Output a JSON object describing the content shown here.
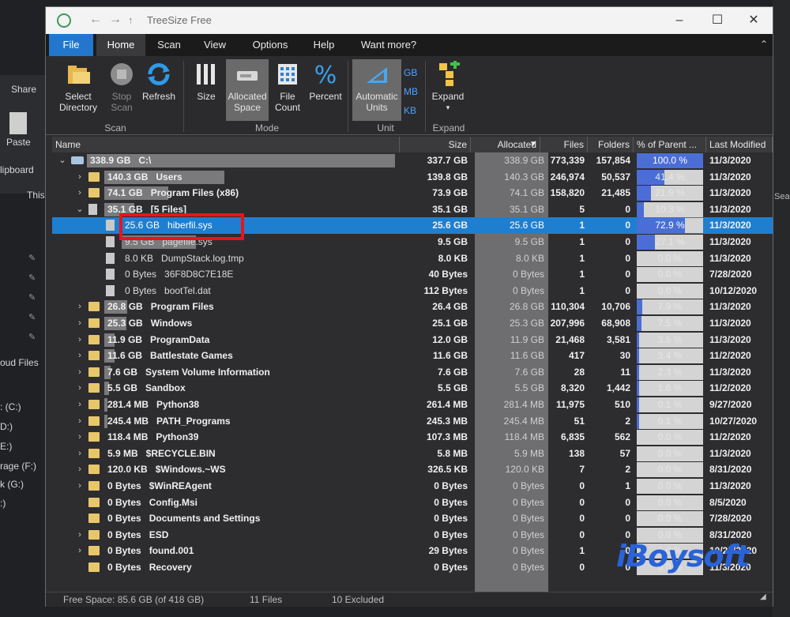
{
  "background": {
    "ribbon_share": "Share",
    "paste": "Paste",
    "clipboard": "lipboard",
    "this_pc": "This",
    "sidebar": [
      "oud Files",
      ": (C:)",
      "D:)",
      "E:)",
      "rage (F:)",
      "k (G:)",
      ":)"
    ],
    "search_partial": "Searc"
  },
  "window": {
    "title": "TreeSize Free",
    "minimize": "–",
    "maximize": "☐",
    "close": "✕"
  },
  "menu": {
    "file": "File",
    "items": [
      "Home",
      "Scan",
      "View",
      "Options",
      "Help",
      "Want more?"
    ],
    "active": "Home"
  },
  "ribbon": {
    "select_directory": "Select Directory",
    "stop_scan": "Stop Scan",
    "refresh": "Refresh",
    "group_scan": "Scan",
    "size": "Size",
    "allocated_space": "Allocated Space",
    "file_count": "File Count",
    "percent": "Percent",
    "group_mode": "Mode",
    "automatic_units": "Automatic Units",
    "gb": "GB",
    "mb": "MB",
    "kb": "KB",
    "group_unit": "Unit",
    "expand": "Expand",
    "group_expand": "Expand"
  },
  "columns": {
    "name": "Name",
    "size": "Size",
    "allocated": "Allocated",
    "files": "Files",
    "folders": "Folders",
    "pct_parent": "% of Parent ...",
    "last_modified": "Last Modified"
  },
  "rows": [
    {
      "name": "338.9 GB   C:\\",
      "size": "337.7 GB",
      "alloc": "338.9 GB",
      "files": "773,339",
      "folders": "157,854",
      "pct": "100.0 %",
      "pct_value": 100.0,
      "date": "11/3/2020",
      "level": 0,
      "type": "drive",
      "expand": "⌄",
      "bar_fraction": 1.0
    },
    {
      "name": "140.3 GB   Users",
      "size": "139.8 GB",
      "alloc": "140.3 GB",
      "files": "246,974",
      "folders": "50,537",
      "pct": "41.4 %",
      "pct_value": 41.4,
      "date": "11/3/2020",
      "level": 1,
      "type": "folder",
      "expand": "›",
      "bar_fraction": 0.414
    },
    {
      "name": "74.1 GB   Program Files (x86)",
      "size": "73.9 GB",
      "alloc": "74.1 GB",
      "files": "158,820",
      "folders": "21,485",
      "pct": "21.9 %",
      "pct_value": 21.9,
      "date": "11/3/2020",
      "level": 1,
      "type": "folder",
      "expand": "›",
      "bar_fraction": 0.219
    },
    {
      "name": "35.1 GB   [5 Files]",
      "size": "35.1 GB",
      "alloc": "35.1 GB",
      "files": "5",
      "folders": "0",
      "pct": "10.3 %",
      "pct_value": 10.3,
      "date": "11/3/2020",
      "level": 1,
      "type": "files",
      "expand": "⌄",
      "bar_fraction": 0.103
    },
    {
      "name": "25.6 GB   hiberfil.sys",
      "size": "25.6 GB",
      "alloc": "25.6 GB",
      "files": "1",
      "folders": "0",
      "pct": "72.9 %",
      "pct_value": 72.9,
      "date": "11/3/2020",
      "level": 2,
      "type": "file",
      "expand": "",
      "bar_fraction": 0.729,
      "selected": true
    },
    {
      "name": "9.5 GB   pagefile.sys",
      "size": "9.5 GB",
      "alloc": "9.5 GB",
      "files": "1",
      "folders": "0",
      "pct": "27.1 %",
      "pct_value": 27.1,
      "date": "11/3/2020",
      "level": 2,
      "type": "file",
      "expand": "",
      "bar_fraction": 0.271
    },
    {
      "name": "8.0 KB   DumpStack.log.tmp",
      "size": "8.0 KB",
      "alloc": "8.0 KB",
      "files": "1",
      "folders": "0",
      "pct": "0.0 %",
      "pct_value": 0.0,
      "date": "11/3/2020",
      "level": 2,
      "type": "file",
      "expand": "",
      "bar_fraction": 0.0
    },
    {
      "name": "0 Bytes   36F8D8C7E18E",
      "size": "40 Bytes",
      "alloc": "0 Bytes",
      "files": "1",
      "folders": "0",
      "pct": "0.0 %",
      "pct_value": 0.0,
      "date": "7/28/2020",
      "level": 2,
      "type": "file",
      "expand": "",
      "bar_fraction": 0.0
    },
    {
      "name": "0 Bytes   bootTel.dat",
      "size": "112 Bytes",
      "alloc": "0 Bytes",
      "files": "1",
      "folders": "0",
      "pct": "0.0 %",
      "pct_value": 0.0,
      "date": "10/12/2020",
      "level": 2,
      "type": "file",
      "expand": "",
      "bar_fraction": 0.0
    },
    {
      "name": "26.8 GB   Program Files",
      "size": "26.4 GB",
      "alloc": "26.8 GB",
      "files": "110,304",
      "folders": "10,706",
      "pct": "7.9 %",
      "pct_value": 7.9,
      "date": "11/3/2020",
      "level": 1,
      "type": "folder",
      "expand": "›",
      "bar_fraction": 0.079
    },
    {
      "name": "25.3 GB   Windows",
      "size": "25.1 GB",
      "alloc": "25.3 GB",
      "files": "207,996",
      "folders": "68,908",
      "pct": "7.5 %",
      "pct_value": 7.5,
      "date": "11/3/2020",
      "level": 1,
      "type": "folder",
      "expand": "›",
      "bar_fraction": 0.075
    },
    {
      "name": "11.9 GB   ProgramData",
      "size": "12.0 GB",
      "alloc": "11.9 GB",
      "files": "21,468",
      "folders": "3,581",
      "pct": "3.5 %",
      "pct_value": 3.5,
      "date": "11/3/2020",
      "level": 1,
      "type": "folder",
      "expand": "›",
      "bar_fraction": 0.035
    },
    {
      "name": "11.6 GB   Battlestate Games",
      "size": "11.6 GB",
      "alloc": "11.6 GB",
      "files": "417",
      "folders": "30",
      "pct": "3.4 %",
      "pct_value": 3.4,
      "date": "11/2/2020",
      "level": 1,
      "type": "folder",
      "expand": "›",
      "bar_fraction": 0.034
    },
    {
      "name": "7.6 GB   System Volume Information",
      "size": "7.6 GB",
      "alloc": "7.6 GB",
      "files": "28",
      "folders": "11",
      "pct": "2.3 %",
      "pct_value": 2.3,
      "date": "11/3/2020",
      "level": 1,
      "type": "folder",
      "expand": "›",
      "bar_fraction": 0.023
    },
    {
      "name": "5.5 GB   Sandbox",
      "size": "5.5 GB",
      "alloc": "5.5 GB",
      "files": "8,320",
      "folders": "1,442",
      "pct": "1.6 %",
      "pct_value": 1.6,
      "date": "11/2/2020",
      "level": 1,
      "type": "folder",
      "expand": "›",
      "bar_fraction": 0.016
    },
    {
      "name": "281.4 MB   Python38",
      "size": "261.4 MB",
      "alloc": "281.4 MB",
      "files": "11,975",
      "folders": "510",
      "pct": "0.1 %",
      "pct_value": 0.1,
      "date": "9/27/2020",
      "level": 1,
      "type": "folder",
      "expand": "›",
      "bar_fraction": 0.001
    },
    {
      "name": "245.4 MB   PATH_Programs",
      "size": "245.3 MB",
      "alloc": "245.4 MB",
      "files": "51",
      "folders": "2",
      "pct": "0.1 %",
      "pct_value": 0.1,
      "date": "10/27/2020",
      "level": 1,
      "type": "folder",
      "expand": "›",
      "bar_fraction": 0.001
    },
    {
      "name": "118.4 MB   Python39",
      "size": "107.3 MB",
      "alloc": "118.4 MB",
      "files": "6,835",
      "folders": "562",
      "pct": "0.0 %",
      "pct_value": 0.0,
      "date": "11/2/2020",
      "level": 1,
      "type": "folder",
      "expand": "›",
      "bar_fraction": 0.0
    },
    {
      "name": "5.9 MB   $RECYCLE.BIN",
      "size": "5.8 MB",
      "alloc": "5.9 MB",
      "files": "138",
      "folders": "57",
      "pct": "0.0 %",
      "pct_value": 0.0,
      "date": "11/3/2020",
      "level": 1,
      "type": "folder",
      "expand": "›",
      "bar_fraction": 0.0
    },
    {
      "name": "120.0 KB   $Windows.~WS",
      "size": "326.5 KB",
      "alloc": "120.0 KB",
      "files": "7",
      "folders": "2",
      "pct": "0.0 %",
      "pct_value": 0.0,
      "date": "8/31/2020",
      "level": 1,
      "type": "folder",
      "expand": "›",
      "bar_fraction": 0.0
    },
    {
      "name": "0 Bytes   $WinREAgent",
      "size": "0 Bytes",
      "alloc": "0 Bytes",
      "files": "0",
      "folders": "1",
      "pct": "0.0 %",
      "pct_value": 0.0,
      "date": "11/3/2020",
      "level": 1,
      "type": "folder",
      "expand": "›",
      "bar_fraction": 0.0
    },
    {
      "name": "0 Bytes   Config.Msi",
      "size": "0 Bytes",
      "alloc": "0 Bytes",
      "files": "0",
      "folders": "0",
      "pct": "0.0 %",
      "pct_value": 0.0,
      "date": "8/5/2020",
      "level": 1,
      "type": "folder",
      "expand": "",
      "bar_fraction": 0.0
    },
    {
      "name": "0 Bytes   Documents and Settings",
      "size": "0 Bytes",
      "alloc": "0 Bytes",
      "files": "0",
      "folders": "0",
      "pct": "0.0 %",
      "pct_value": 0.0,
      "date": "7/28/2020",
      "level": 1,
      "type": "folder",
      "expand": "",
      "bar_fraction": 0.0
    },
    {
      "name": "0 Bytes   ESD",
      "size": "0 Bytes",
      "alloc": "0 Bytes",
      "files": "0",
      "folders": "0",
      "pct": "0.0 %",
      "pct_value": 0.0,
      "date": "8/31/2020",
      "level": 1,
      "type": "folder",
      "expand": "›",
      "bar_fraction": 0.0
    },
    {
      "name": "0 Bytes   found.001",
      "size": "29 Bytes",
      "alloc": "0 Bytes",
      "files": "1",
      "folders": "0",
      "pct": "0.0 %",
      "pct_value": 0.0,
      "date": "10/25/2020",
      "level": 1,
      "type": "folder",
      "expand": "›",
      "bar_fraction": 0.0
    },
    {
      "name": "0 Bytes   Recovery",
      "size": "0 Bytes",
      "alloc": "0 Bytes",
      "files": "0",
      "folders": "0",
      "pct": "0.0 %",
      "pct_value": 0.0,
      "date": "11/3/2020",
      "level": 1,
      "type": "folder",
      "expand": "",
      "bar_fraction": 0.0
    }
  ],
  "status": {
    "free_space": "Free Space: 85.6 GB  (of 418 GB)",
    "files": "11 Files",
    "excluded": "10 Excluded"
  },
  "watermark": "iBoysoft",
  "colors": {
    "selection": "#1e7fd0",
    "highlight_box": "#e8141c",
    "pct_fill": "#4b6ed6",
    "folder": "#e8c66a"
  }
}
